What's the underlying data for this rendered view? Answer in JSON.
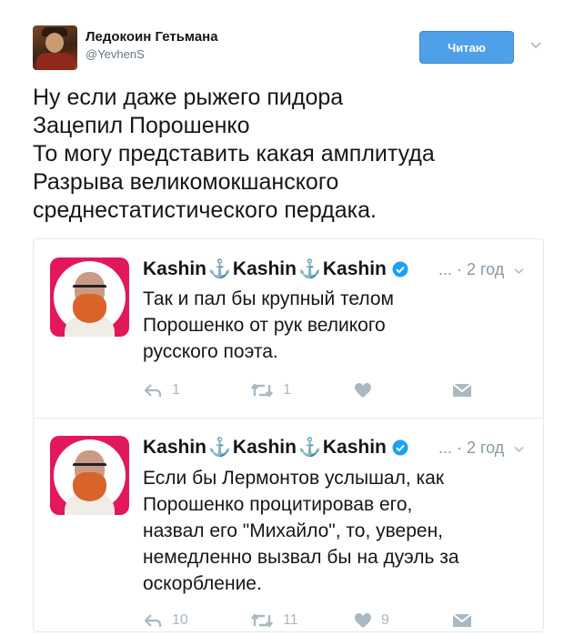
{
  "author": {
    "name": "Ледокоин Гетьмана",
    "handle": "@YevhenS"
  },
  "follow_button": "Читаю",
  "tweet_lines": [
    "Ну если даже рыжего пидора",
    "Зацепил Порошенко",
    "То могу представить какая амплитуда",
    "Разрыва великомокшанского",
    "среднестатистического пердака."
  ],
  "quotes": [
    {
      "name_parts": [
        "Kashin",
        "⚓",
        "Kashin",
        "⚓",
        "Kashin"
      ],
      "meta": "... · 2 год",
      "text_lines": [
        "Так и пал бы крупный телом",
        "Порошенко от рук великого",
        "русского поэта."
      ],
      "reply_count": "1",
      "retweet_count": "1",
      "like_count": ""
    },
    {
      "name_parts": [
        "Kashin",
        "⚓",
        "Kashin",
        "⚓",
        "Kashin"
      ],
      "meta": "... · 2 год",
      "text_lines": [
        "Если бы Лермонтов услышал, как",
        "Порошенко процитировав его,",
        "назвал его \"Михайло\", то, уверен,",
        "немедленно вызвал бы на дуэль за",
        "оскорбление."
      ],
      "reply_count": "10",
      "retweet_count": "11",
      "like_count": "9"
    }
  ],
  "colors": {
    "accent": "#4ea1e8",
    "verified": "#1da1f2",
    "muted": "#8899a6",
    "avatar_bg": "#e2185a"
  },
  "icons": [
    "reply-icon",
    "retweet-icon",
    "like-icon",
    "message-icon",
    "verified-icon",
    "chevron-down-icon"
  ]
}
